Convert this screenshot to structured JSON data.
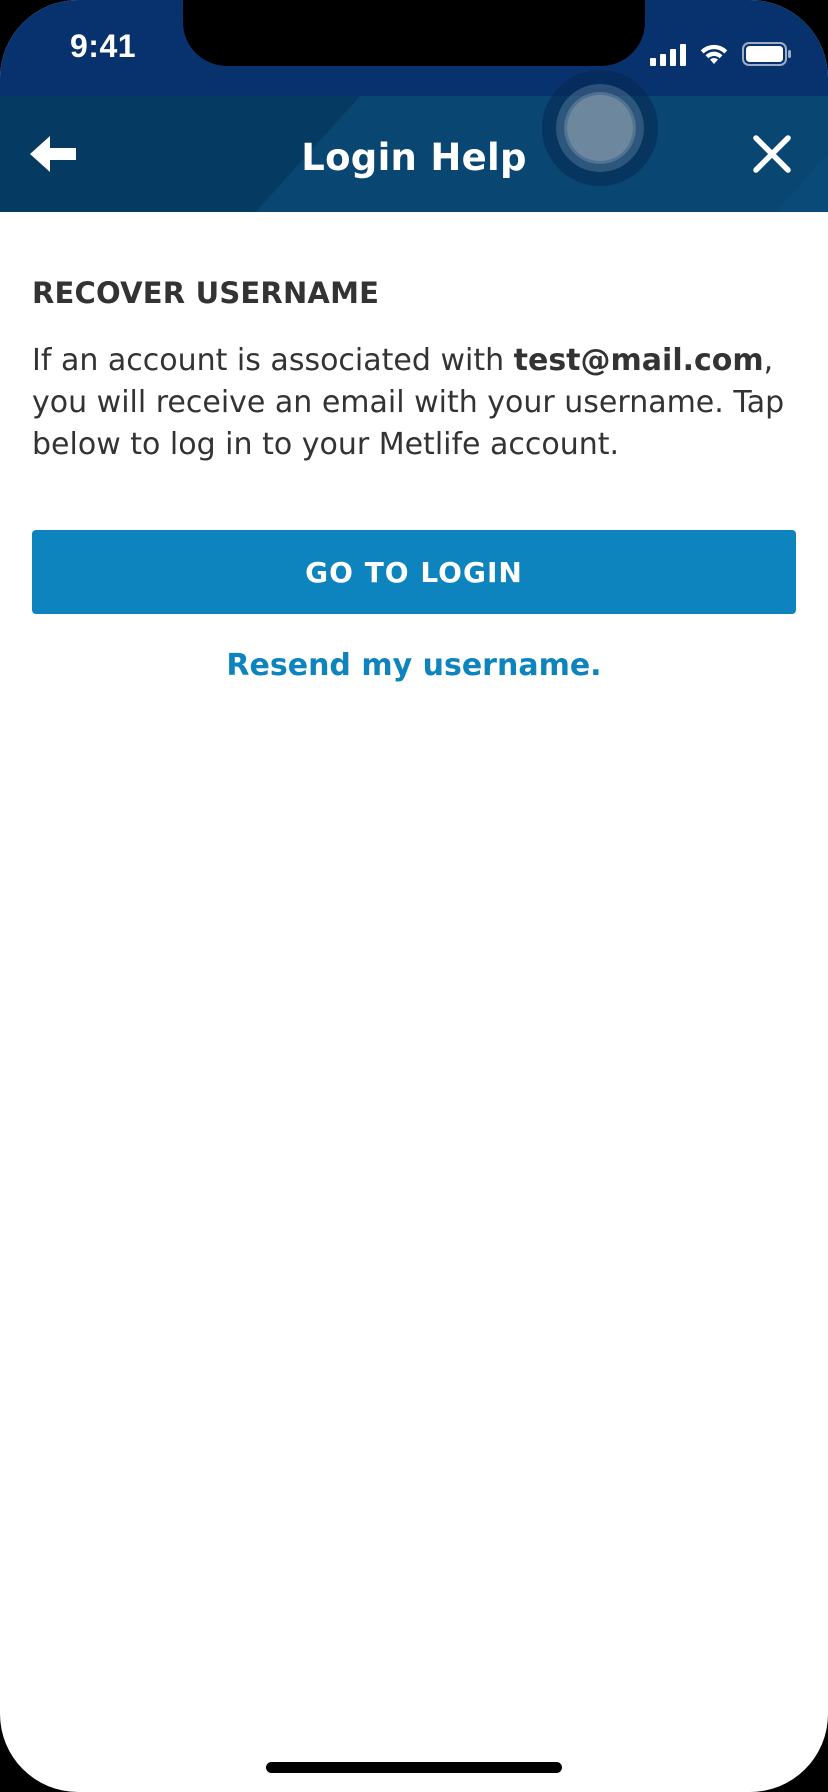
{
  "status_bar": {
    "time": "9:41",
    "icons": [
      "signal-icon",
      "wifi-icon",
      "battery-icon"
    ]
  },
  "header": {
    "title": "Login Help",
    "back_icon": "arrow-left-icon",
    "close_icon": "close-icon",
    "background_color": "#053a62"
  },
  "content": {
    "heading": "RECOVER USERNAME",
    "message_prefix": "If an account is associated with ",
    "email": "test@mail.com",
    "message_suffix": ", you will receive an email with your username. Tap below to log in to your Metlife account.",
    "login_button_label": "GO TO LOGIN",
    "resend_link_label": "Resend my username."
  },
  "colors": {
    "accent": "#0d84bd",
    "status_bar": "#08326e",
    "text": "#333333"
  }
}
